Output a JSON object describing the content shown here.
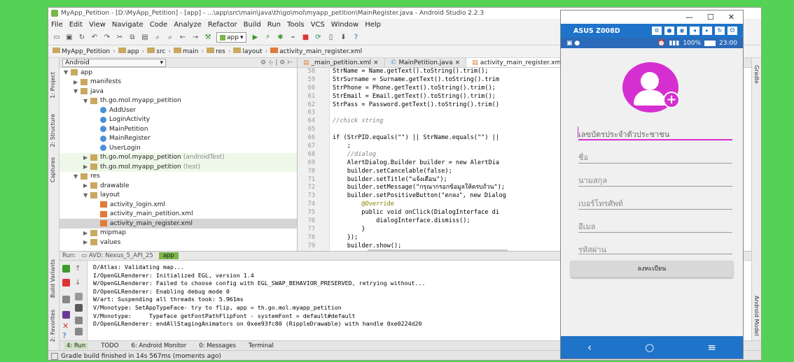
{
  "ide": {
    "title": "MyApp_Petition - [D:\\MyApp_Petition] - [app] - ...\\app\\src\\main\\java\\th\\go\\mol\\myapp_petition\\MainRegister.java - Android Studio 2.2.3",
    "menu": [
      "File",
      "Edit",
      "View",
      "Navigate",
      "Code",
      "Analyze",
      "Refactor",
      "Build",
      "Run",
      "Tools",
      "VCS",
      "Window",
      "Help"
    ],
    "toolbar_app": "app",
    "breadcrumb": [
      "MyApp_Petition",
      "app",
      "src",
      "main",
      "res",
      "layout",
      "activity_main_register.xml"
    ],
    "project_view": "Android",
    "left_tabs": [
      "1: Project",
      "2: Structure",
      "Captures",
      "Build Variants",
      "2: Favorites"
    ],
    "right_tabs": [
      "Gradle",
      "Android Model"
    ],
    "tree": [
      {
        "label": "app",
        "depth": 0,
        "arrow": "▼",
        "icon": "fold2"
      },
      {
        "label": "manifests",
        "depth": 1,
        "arrow": "▶",
        "icon": "fold2"
      },
      {
        "label": "java",
        "depth": 1,
        "arrow": "▼",
        "icon": "fold2"
      },
      {
        "label": "th.go.mol.myapp_petition",
        "depth": 2,
        "arrow": "▼",
        "icon": "fold2"
      },
      {
        "label": "AddUser",
        "depth": 3,
        "arrow": "",
        "icon": "cls"
      },
      {
        "label": "LoginActivity",
        "depth": 3,
        "arrow": "",
        "icon": "cls"
      },
      {
        "label": "MainPetition",
        "depth": 3,
        "arrow": "",
        "icon": "cls"
      },
      {
        "label": "MainRegister",
        "depth": 3,
        "arrow": "",
        "icon": "cls"
      },
      {
        "label": "UserLogin",
        "depth": 3,
        "arrow": "",
        "icon": "cls"
      },
      {
        "label": "th.go.mol.myapp_petition",
        "muted": "(androidTest)",
        "depth": 2,
        "arrow": "▶",
        "icon": "fold2",
        "green": true
      },
      {
        "label": "th.go.mol.myapp_petition",
        "muted": "(test)",
        "depth": 2,
        "arrow": "▶",
        "icon": "fold2",
        "green": true
      },
      {
        "label": "res",
        "depth": 1,
        "arrow": "▼",
        "icon": "fold2"
      },
      {
        "label": "drawable",
        "depth": 2,
        "arrow": "▶",
        "icon": "fold2"
      },
      {
        "label": "layout",
        "depth": 2,
        "arrow": "▼",
        "icon": "fold2"
      },
      {
        "label": "activity_login.xml",
        "depth": 3,
        "arrow": "",
        "icon": "xml"
      },
      {
        "label": "activity_main_petition.xml",
        "depth": 3,
        "arrow": "",
        "icon": "xml"
      },
      {
        "label": "activity_main_register.xml",
        "depth": 3,
        "arrow": "",
        "icon": "xml",
        "selected": true
      },
      {
        "label": "mipmap",
        "depth": 2,
        "arrow": "▶",
        "icon": "fold2"
      },
      {
        "label": "values",
        "depth": 2,
        "arrow": "▶",
        "icon": "fold2"
      }
    ],
    "editor_tabs": [
      "_main_petition.xml",
      "MainPetition.java",
      "activity_main_register.xml",
      "AddU"
    ],
    "line_numbers": [
      "58",
      "59",
      "60",
      "61",
      "62",
      "63",
      "64",
      "65",
      "66",
      "67",
      "68",
      "69",
      "70",
      "71",
      "72",
      "73",
      "74",
      "75",
      "76",
      "77",
      "78",
      "79"
    ],
    "code": [
      "StrName = Name.getText().toString().trim();",
      "StrSurname = Surname.getText().toString().trim",
      "StrPhone = Phone.getText().toString().trim();",
      "StrEmail = Email.getText().toString().trim();",
      "StrPass = Password.getText().toString().trim()",
      "",
      "//chick string",
      "",
      "if (StrPID.equals(\"\") || StrName.equals(\"\") ||",
      "    ;",
      "    //dialog",
      "    AlertDialog.Builder builder = new AlertDia",
      "    builder.setCancelable(false);",
      "    builder.setTitle(\"แจ้งเตือน\");",
      "    builder.setMessage(\"กรุณากรอกข้อมูลให้ครบถ้วน\");",
      "    builder.setPositiveButton(\"ตกลง\", new Dialog",
      "        @Override",
      "        public void onClick(DialogInterface di",
      "            dialogInterface.dismiss();",
      "        }",
      "    });",
      "    builder.show();"
    ],
    "run_label": "Run:",
    "run_tabs": [
      "AVD: Nexus_5_API_25",
      "app"
    ],
    "console": [
      "D/Atlas: Validating map...",
      "I/OpenGLRenderer: Initialized EGL, version 1.4",
      "W/OpenGLRenderer: Failed to choose config with EGL_SWAP_BEHAVIOR_PRESERVED, retrying without...",
      "D/OpenGLRenderer: Enabling debug mode 0",
      "W/art: Suspending all threads took: 5.961ms",
      "V/Monotype: SetAppTypeFace- try to flip, app = th.go.mol.myapp_petition",
      "V/Monotype:     Typeface getFontPathFlipFont - systemFont = default#default",
      "D/OpenGLRenderer: endAllStagingAnimators on 0xee93fc80 (RippleDrawable) with handle 0xe0224d20"
    ],
    "bottom_tabs": [
      "4: Run",
      "TODO",
      "6: Android Monitor",
      "0: Messages",
      "Terminal"
    ],
    "status": "Gradle build finished in 14s 567ms (moments ago)"
  },
  "emulator": {
    "device": "ASUS Z008D",
    "battery": "100%",
    "time": "23:00",
    "fields": [
      "เลขบัตรประจำตัวประชาชน",
      "ชื่อ",
      "นามสกุล",
      "เบอร์โทรศัพท์",
      "อีเมล",
      "รหัสผ่าน"
    ],
    "register_label": "ลงทะเบียน",
    "accent": "#d62fd0"
  }
}
